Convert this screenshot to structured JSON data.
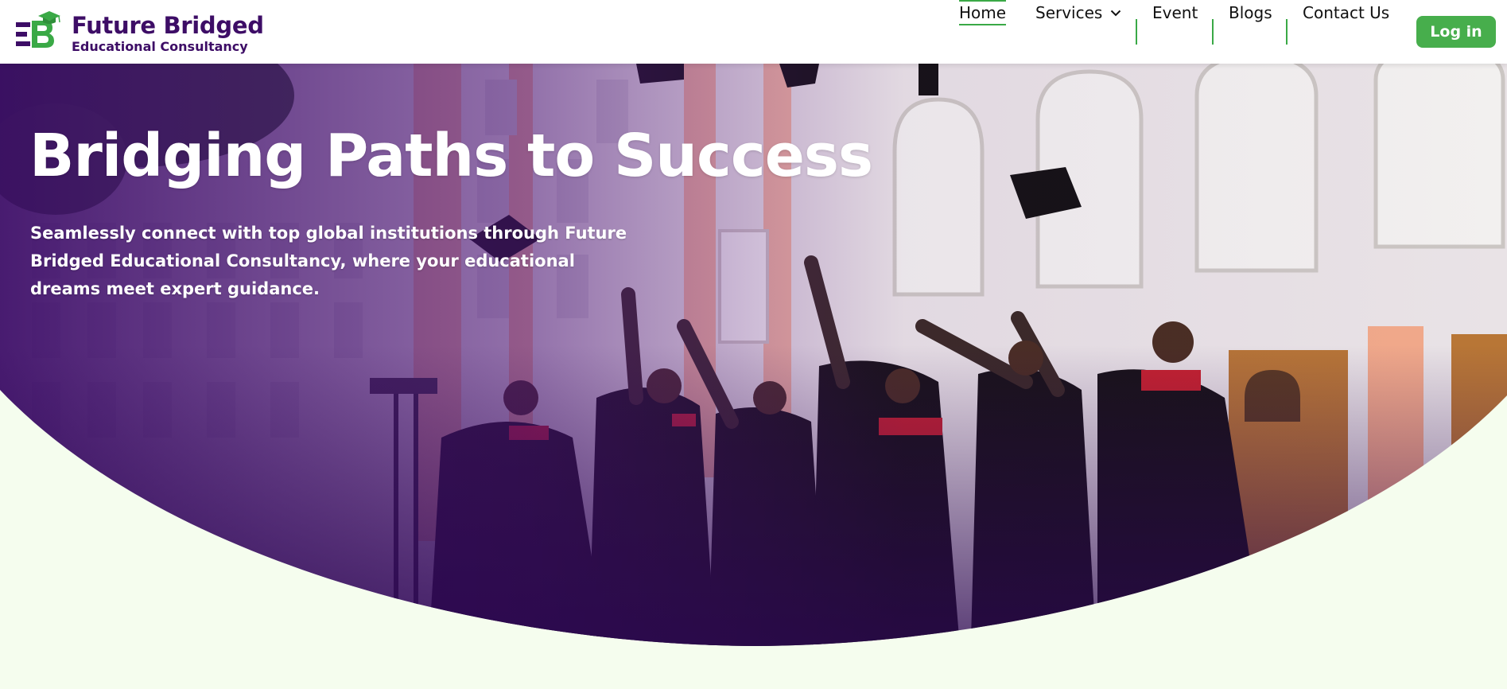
{
  "brand": {
    "title": "Future Bridged",
    "subtitle": "Educational Consultancy",
    "logo_icon": "fb-logo-icon"
  },
  "nav": {
    "items": [
      {
        "label": "Home",
        "active": true
      },
      {
        "label": "Services",
        "has_dropdown": true,
        "dropdown_icon": "chevron-down-icon"
      },
      {
        "label": "Event"
      },
      {
        "label": "Blogs"
      },
      {
        "label": "Contact Us"
      }
    ],
    "login_label": "Log in"
  },
  "hero": {
    "heading": "Bridging Paths to Success",
    "subheading": "Seamlessly connect with top global institutions through Future Bridged Educational Consultancy, where your educational dreams meet expert guidance.",
    "image_subject": "graduates-throwing-caps-photo"
  },
  "colors": {
    "brand_purple": "#3d0d66",
    "accent_green": "#47ae4c",
    "page_background": "#f5fdee",
    "nav_text": "#111111"
  }
}
